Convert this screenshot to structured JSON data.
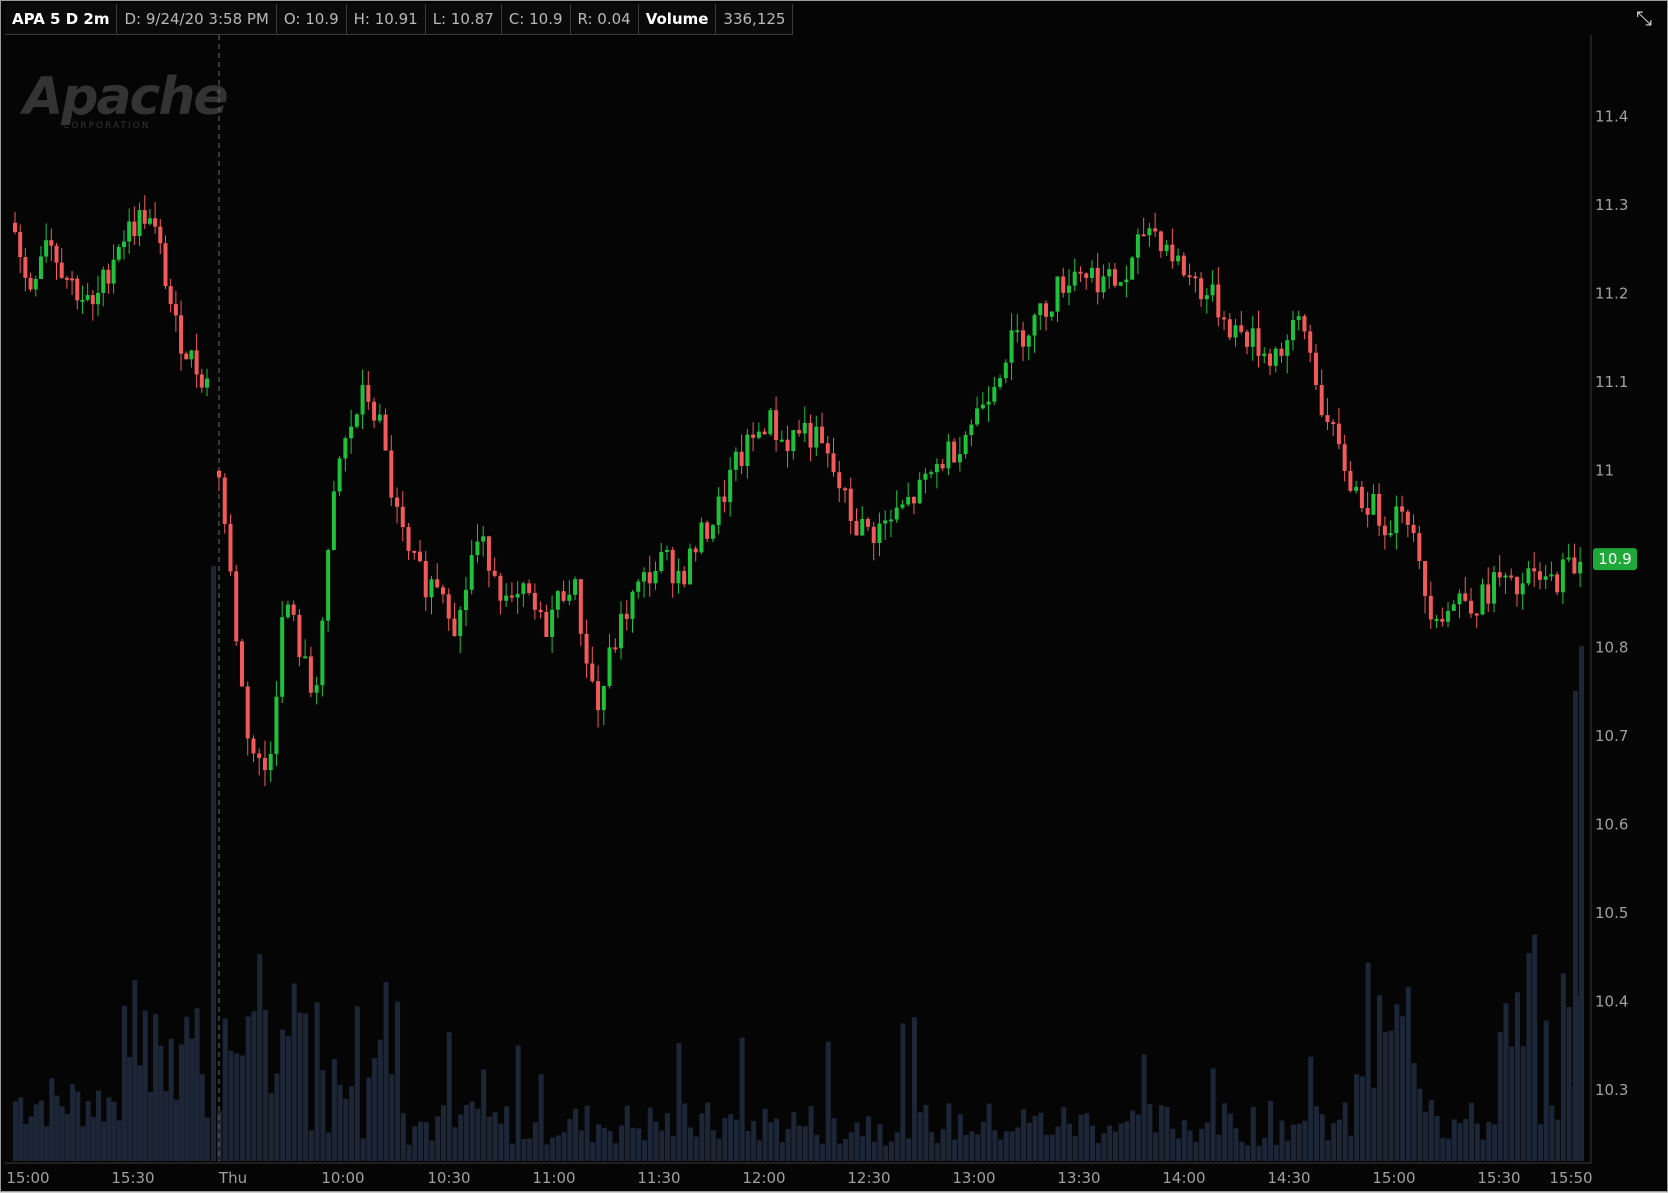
{
  "header": {
    "symbol": "APA 5 D 2m",
    "date": "D: 9/24/20 3:58 PM",
    "open": "O: 10.9",
    "high": "H: 10.91",
    "low": "L: 10.87",
    "close": "C: 10.9",
    "range": "R: 0.04",
    "volume_label": "Volume",
    "volume_value": "336,125",
    "collapse_icon": "collapse-arrows-icon"
  },
  "logo": {
    "text": "Apache",
    "subtext": "CORPORATION"
  },
  "colors": {
    "background": "#050505",
    "up": "#1fc13a",
    "down": "#f25a5a",
    "volume": "#1c2636",
    "text": "#a0a0a0",
    "last_price_tag": "#1fa83a"
  },
  "chart_data": {
    "type": "candlestick",
    "title": "APA 5 D 2m",
    "last_price": "10.9",
    "y_ticks": [
      "11.4",
      "11.3",
      "11.2",
      "11.1",
      "11",
      "10.8",
      "10.7",
      "10.6",
      "10.5",
      "10.4",
      "10.3"
    ],
    "ylim": [
      10.22,
      11.49
    ],
    "x_tick_labels": [
      "15:00",
      "15:30",
      "Thu",
      "10:00",
      "10:30",
      "11:00",
      "11:30",
      "12:00",
      "12:30",
      "13:00",
      "13:30",
      "14:00",
      "14:30",
      "15:00",
      "15:30",
      "15:50"
    ],
    "session_break_label": "Thu",
    "series": [
      {
        "name": "Price",
        "segments": [
          [
            0,
            11.28
          ],
          [
            5,
            11.2
          ],
          [
            12,
            11.27
          ],
          [
            20,
            11.22
          ],
          [
            30,
            11.18
          ],
          [
            40,
            11.26
          ],
          [
            50,
            11.29
          ],
          [
            55,
            11.26
          ],
          [
            62,
            11.16
          ],
          [
            69,
            11.12
          ],
          [
            74,
            11.1
          ]
        ]
      },
      {
        "name": "Price_day2",
        "segments": [
          [
            75,
            11.0
          ],
          [
            79,
            10.88
          ],
          [
            84,
            10.72
          ],
          [
            88,
            10.67
          ],
          [
            92,
            10.66
          ],
          [
            98,
            10.86
          ],
          [
            103,
            10.8
          ],
          [
            108,
            10.74
          ],
          [
            112,
            10.86
          ],
          [
            116,
            11.0
          ],
          [
            121,
            11.05
          ],
          [
            126,
            11.09
          ],
          [
            131,
            11.05
          ],
          [
            136,
            10.96
          ],
          [
            141,
            10.9
          ],
          [
            148,
            10.87
          ],
          [
            152,
            10.88
          ],
          [
            158,
            10.82
          ],
          [
            164,
            10.92
          ],
          [
            170,
            10.9
          ],
          [
            176,
            10.84
          ],
          [
            182,
            10.86
          ],
          [
            188,
            10.82
          ],
          [
            194,
            10.86
          ],
          [
            198,
            10.88
          ],
          [
            203,
            10.79
          ],
          [
            207,
            10.73
          ],
          [
            212,
            10.8
          ],
          [
            218,
            10.85
          ],
          [
            224,
            10.88
          ],
          [
            230,
            10.9
          ],
          [
            236,
            10.88
          ],
          [
            242,
            10.92
          ],
          [
            248,
            10.95
          ],
          [
            254,
            11.0
          ],
          [
            260,
            11.03
          ],
          [
            266,
            11.06
          ],
          [
            272,
            11.03
          ],
          [
            278,
            11.05
          ],
          [
            284,
            11.03
          ],
          [
            290,
            10.99
          ],
          [
            296,
            10.94
          ],
          [
            302,
            10.93
          ],
          [
            308,
            10.94
          ],
          [
            314,
            10.96
          ],
          [
            320,
            10.98
          ],
          [
            326,
            11.01
          ],
          [
            332,
            11.03
          ],
          [
            338,
            11.06
          ],
          [
            344,
            11.1
          ],
          [
            350,
            11.14
          ],
          [
            356,
            11.16
          ],
          [
            362,
            11.18
          ],
          [
            368,
            11.21
          ],
          [
            374,
            11.23
          ],
          [
            380,
            11.22
          ],
          [
            386,
            11.21
          ],
          [
            392,
            11.22
          ],
          [
            398,
            11.28
          ],
          [
            404,
            11.26
          ],
          [
            410,
            11.23
          ],
          [
            416,
            11.21
          ],
          [
            422,
            11.19
          ],
          [
            428,
            11.16
          ],
          [
            434,
            11.15
          ],
          [
            440,
            11.13
          ],
          [
            446,
            11.14
          ],
          [
            452,
            11.17
          ],
          [
            456,
            11.12
          ],
          [
            460,
            11.06
          ],
          [
            465,
            11.02
          ],
          [
            470,
            10.98
          ],
          [
            476,
            10.96
          ],
          [
            482,
            10.94
          ],
          [
            488,
            10.97
          ],
          [
            492,
            10.9
          ],
          [
            496,
            10.85
          ],
          [
            502,
            10.84
          ],
          [
            508,
            10.86
          ],
          [
            514,
            10.85
          ],
          [
            520,
            10.88
          ],
          [
            526,
            10.86
          ],
          [
            532,
            10.88
          ],
          [
            538,
            10.87
          ],
          [
            544,
            10.89
          ],
          [
            550,
            10.9
          ]
        ]
      }
    ],
    "volume_note": "volume histogram bars at bottom, peaks at session open and close"
  }
}
